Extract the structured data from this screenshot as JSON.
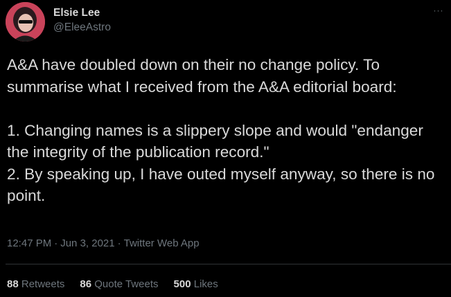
{
  "tweet": {
    "author": {
      "display_name": "Elsie Lee",
      "handle": "@EleeAstro",
      "avatar_icon": "profile-avatar"
    },
    "more_icon": "more-options-icon",
    "more_glyph": "···",
    "text": "A&A have doubled down on their no change policy. To summarise what I received from the A&A editorial board:\n\n1. Changing names is a slippery slope and would \"endanger the integrity of the publication record.\"\n2. By speaking up, I have outed myself anyway, so there is no point.",
    "meta": {
      "time": "12:47 PM",
      "separator": "·",
      "date": "Jun 3, 2021",
      "source": "Twitter Web App"
    },
    "stats": {
      "retweets": {
        "count": "88",
        "label": "Retweets"
      },
      "quote_tweets": {
        "count": "86",
        "label": "Quote Tweets"
      },
      "likes": {
        "count": "500",
        "label": "Likes"
      }
    }
  },
  "colors": {
    "background": "#000000",
    "primary_text": "#D9D9D9",
    "secondary_text": "#6E767D",
    "divider": "#2F3336"
  }
}
